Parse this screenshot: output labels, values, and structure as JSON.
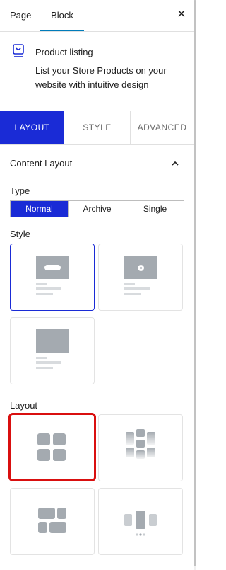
{
  "top_tabs": {
    "page": "Page",
    "block": "Block",
    "close": "✕"
  },
  "block": {
    "title": "Product listing",
    "description": "List your Store Products on your website with intuitive design",
    "icon": "product-listing-icon"
  },
  "section_tabs": {
    "layout": "LAYOUT",
    "style": "STYLE",
    "advanced": "ADVANCED",
    "active": "LAYOUT"
  },
  "content_layout": {
    "title": "Content Layout",
    "type_label": "Type",
    "type_options": [
      "Normal",
      "Archive",
      "Single"
    ],
    "type_selected": "Normal",
    "style_label": "Style",
    "layout_label": "Layout"
  },
  "colors": {
    "accent": "#1a2bd6",
    "highlight": "#d90f0f",
    "placeholder": "#a4aab0"
  }
}
